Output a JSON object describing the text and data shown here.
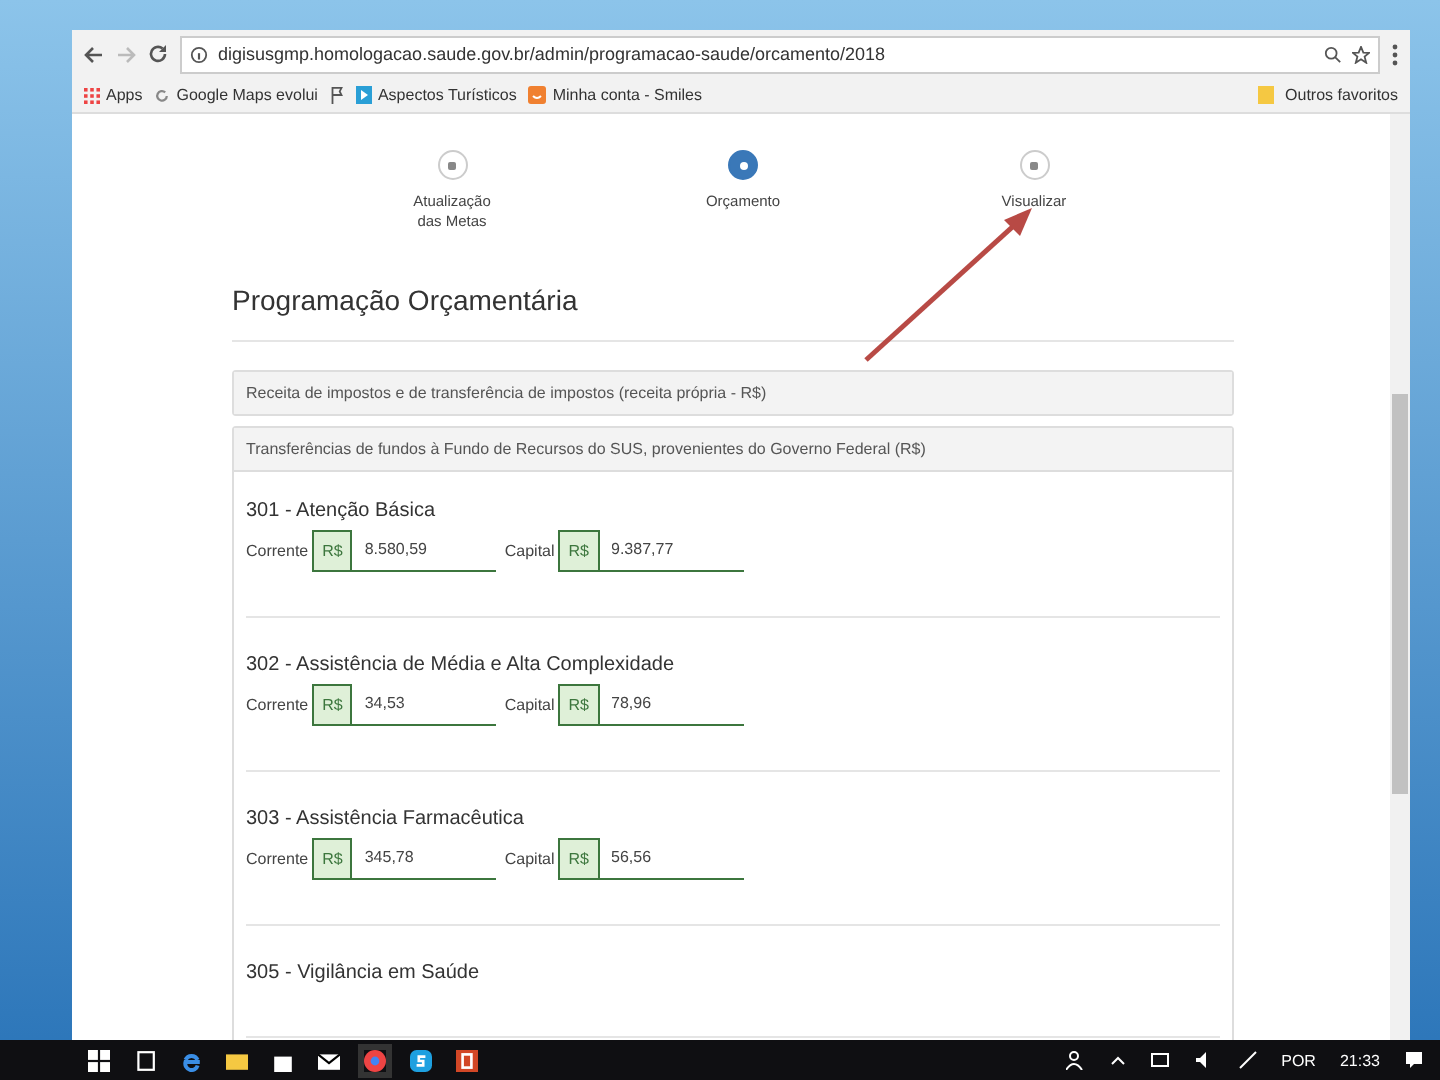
{
  "browser": {
    "url": "digisusgmp.homologacao.saude.gov.br/admin/programacao-saude/orcamento/2018",
    "bookmarks": [
      {
        "kind": "apps",
        "label": "Apps"
      },
      {
        "kind": "maps",
        "label": "Google Maps evolui"
      },
      {
        "kind": "flag"
      },
      {
        "kind": "play",
        "label": "Aspectos Turísticos"
      },
      {
        "kind": "smiles",
        "label": "Minha conta - Smiles"
      }
    ],
    "other_bookmarks": "Outros favoritos"
  },
  "steps": [
    {
      "label": "Atualização das Metas",
      "selected": false
    },
    {
      "label": "Orçamento",
      "selected": true
    },
    {
      "label": "Visualizar",
      "selected": false
    }
  ],
  "page_title": "Programação Orçamentária",
  "sections": [
    {
      "title": "Receita de impostos e de transferência de impostos (receita própria - R$)",
      "expanded": false
    },
    {
      "title": "Transferências de fundos à Fundo de Recursos do SUS, provenientes do Governo Federal (R$)",
      "expanded": true,
      "items": [
        {
          "title": "301 - Atenção Básica",
          "fields": [
            {
              "label": "Corrente",
              "prefix": "R$",
              "value": "8.580,59"
            },
            {
              "label": "Capital",
              "prefix": "R$",
              "value": "9.387,77"
            }
          ]
        },
        {
          "title": "302 - Assistência de Média e Alta Complexidade",
          "fields": [
            {
              "label": "Corrente",
              "prefix": "R$",
              "value": "34,53"
            },
            {
              "label": "Capital",
              "prefix": "R$",
              "value": "78,96"
            }
          ]
        },
        {
          "title": "303 - Assistência Farmacêutica",
          "fields": [
            {
              "label": "Corrente",
              "prefix": "R$",
              "value": "345,78"
            },
            {
              "label": "Capital",
              "prefix": "R$",
              "value": "56,56"
            }
          ]
        },
        {
          "title": "305 - Vigilância em Saúde"
        }
      ]
    }
  ],
  "taskbar": {
    "language": "POR",
    "time": "21:33"
  }
}
